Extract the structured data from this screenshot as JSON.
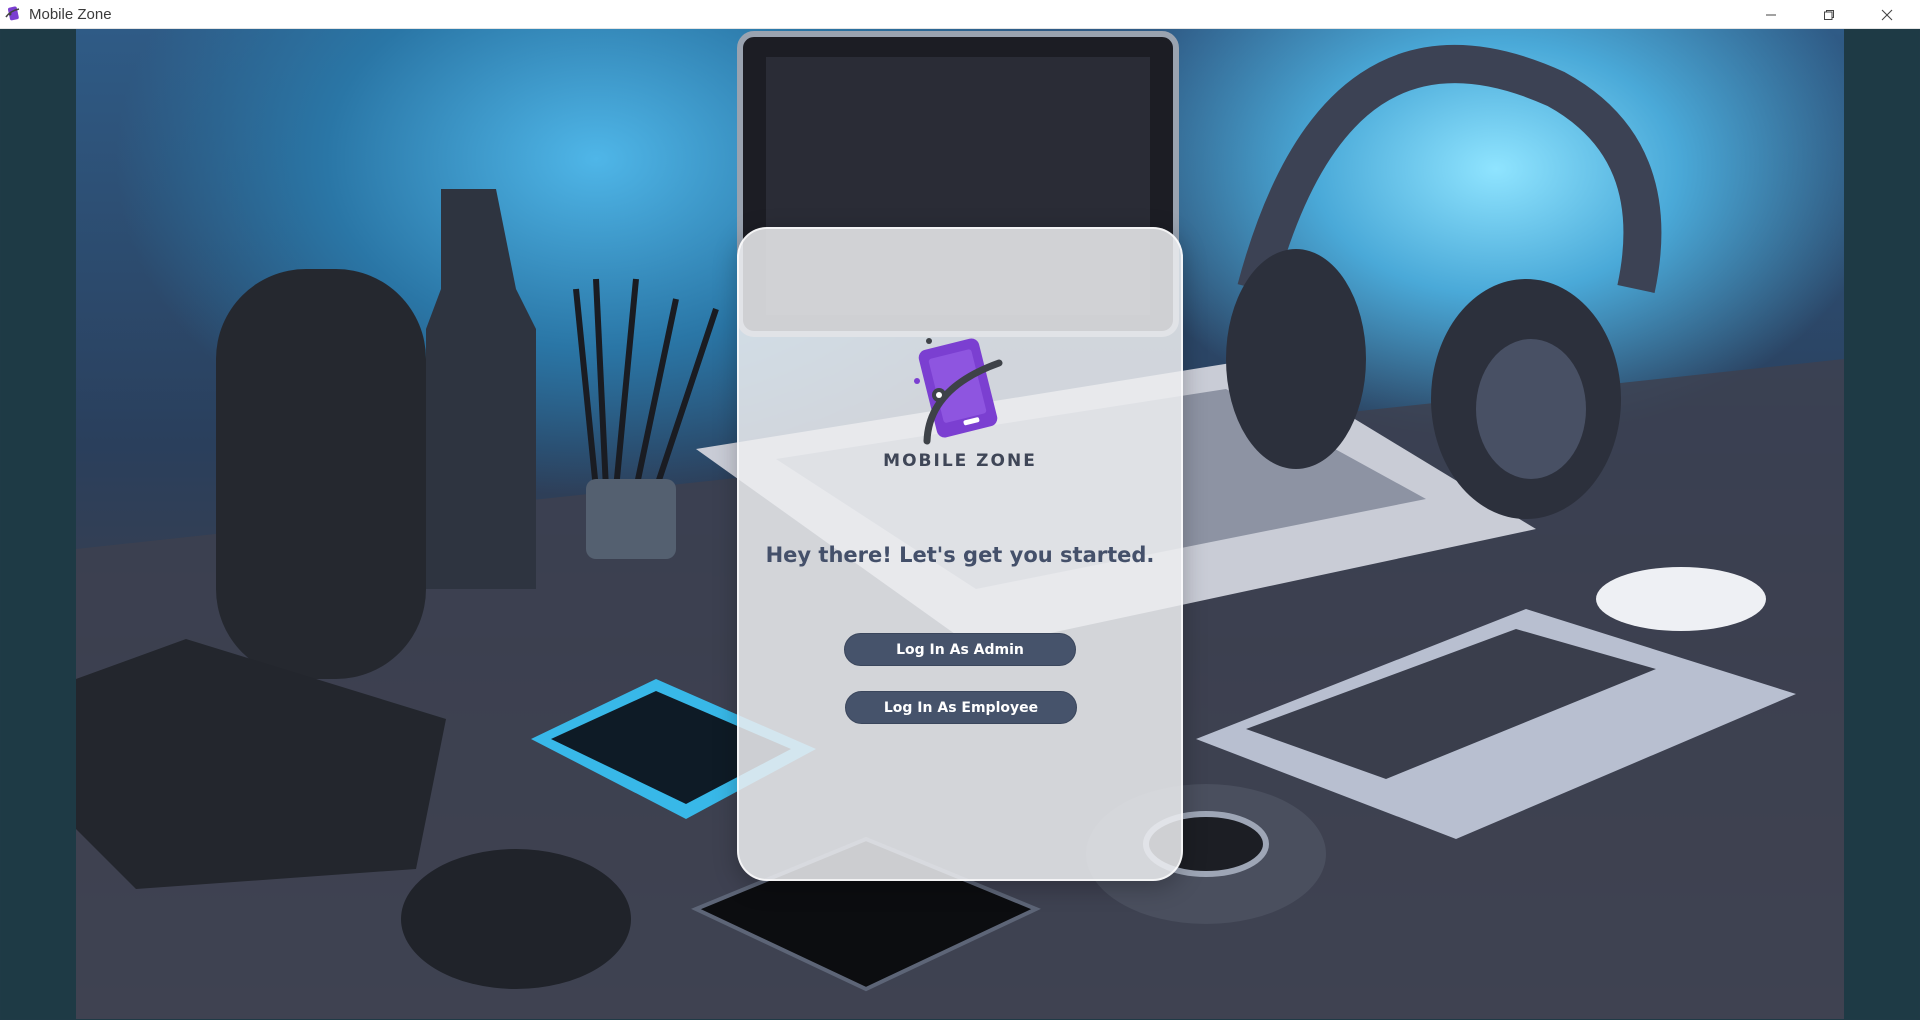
{
  "window": {
    "title": "Mobile Zone",
    "icon": "mobile-zone-app-icon",
    "controls": [
      "minimize-icon",
      "restore-icon",
      "close-icon"
    ]
  },
  "brand": {
    "name": "MOBILE ZONE",
    "accent_color": "#7b3fd1",
    "text_color": "#3f4657"
  },
  "login": {
    "headline": "Hey there! Let's get you started.",
    "admin_button": "Log In As Admin",
    "employee_button": "Log In As Employee",
    "button_color": "#46536b"
  }
}
